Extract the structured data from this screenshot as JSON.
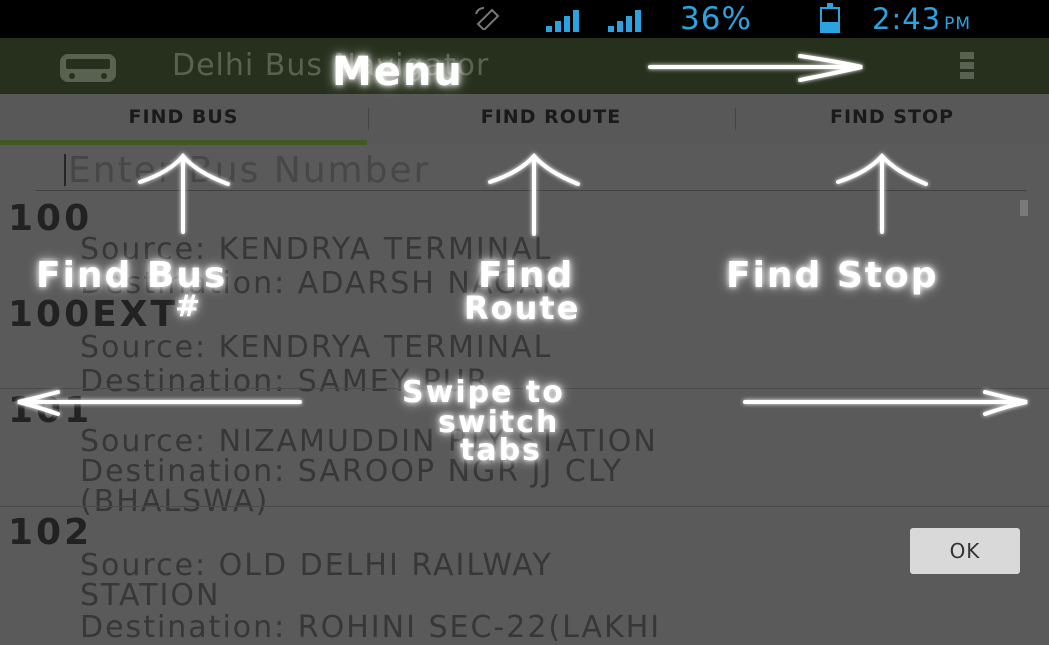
{
  "status_bar": {
    "battery_percent": "36%",
    "time": "2:43",
    "ampm": "PM",
    "icons": [
      "screen-rotation-icon",
      "signal-icon",
      "signal-icon",
      "battery-icon"
    ]
  },
  "action_bar": {
    "title": "Delhi Bus Navigator",
    "icon": "bus-icon",
    "menu_icon": "overflow-menu-icon"
  },
  "tabs": [
    {
      "label": "FIND BUS",
      "selected": true
    },
    {
      "label": "FIND ROUTE",
      "selected": false
    },
    {
      "label": "FIND STOP",
      "selected": false
    }
  ],
  "search": {
    "placeholder": "Enter Bus Number"
  },
  "buses": [
    {
      "number": "100",
      "source": "Source: KENDRYA TERMINAL",
      "destination": "Destination: ADARSH NAGAR",
      "extra": ""
    },
    {
      "number": "100EXT",
      "source": "Source: KENDRYA TERMINAL",
      "destination": "Destination: SAMEY PUR",
      "extra": ""
    },
    {
      "number": "101",
      "source": "Source: NIZAMUDDIN RLY STATION",
      "destination": "Destination: SAROOP NGR JJ CLY",
      "extra": "(BHALSWA)"
    },
    {
      "number": "102",
      "source": "Source: OLD DELHI RAILWAY",
      "destination": "STATION",
      "extra": "Destination: ROHINI SEC-22(LAKHI"
    }
  ],
  "overlay": {
    "menu": "Menu",
    "find_bus_line1": "Find Bus",
    "find_bus_line2": "#",
    "find_route_line1": "Find",
    "find_route_line2": "Route",
    "find_stop": "Find Stop",
    "swipe_line1": "Swipe to",
    "swipe_line2": "switch",
    "swipe_line3": "tabs",
    "ok_button": "OK"
  },
  "colors": {
    "status_text": "#2aa3e0",
    "action_bar_bg": "#27301d",
    "tab_indicator": "#405a22",
    "overlay_dim": "#5a5a5a"
  }
}
